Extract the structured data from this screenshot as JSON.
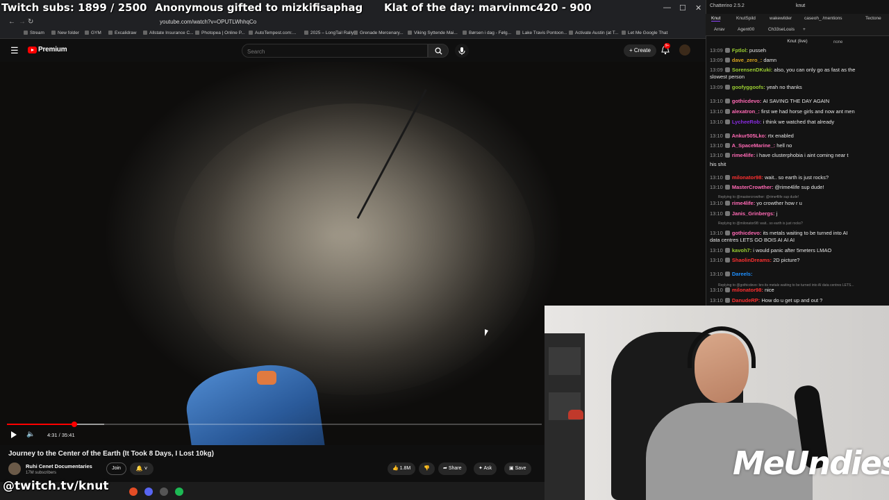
{
  "overlay": {
    "subs": "Twitch subs: 1899 / 2500",
    "gifted": "Anonymous gifted to mizkifisaphag",
    "klat": "Klat of the day: marvinmc420 - 900"
  },
  "browser": {
    "url": "youtube.com/watch?v=OPUTLWhhqCo",
    "bookmarks": [
      "Stream",
      "New folder",
      "GYM",
      "Excalidraw",
      "Allstate Insurance C...",
      "Photopea | Online P...",
      "AutoTempest.com:...",
      "2025 – LongTail Rally",
      "Grenade Mercenary...",
      "Viking Syttende Mai...",
      "Børsen i dag - Følg...",
      "Lake Travis Pontoon...",
      "Activate Austin (at T...",
      "Let Me Google That"
    ]
  },
  "youtube": {
    "brand": "Premium",
    "search_placeholder": "Search",
    "create_label": "Create",
    "notifications": "9+",
    "time": "4:31 / 35:41",
    "progress": 0.126,
    "title": "Journey to the Center of the Earth (It Took 8 Days, I Lost 10kg)",
    "channel": "Ruhi Cenet Documentaries",
    "subscribers": "17M subscribers",
    "join_label": "Join",
    "likes": "1.8M",
    "share_label": "Share",
    "ask_label": "Ask",
    "save_label": "Save"
  },
  "chat": {
    "app_title": "Chatterino 2.5.2",
    "user": "knut",
    "tabs_row1": [
      "Knut",
      "KnutSpild",
      "wakewilder",
      "caseoh_ /mentions",
      "Tectone"
    ],
    "tabs_row2": [
      "Arrav",
      "Agent00",
      "Ch33seLouis"
    ],
    "channel": "Knut (live)",
    "mode": "none",
    "messages": [
      {
        "time": "13:09",
        "user": "Fptlol:",
        "color": "#9acd32",
        "text": "pusseh"
      },
      {
        "time": "13:09",
        "user": "dave_zero_:",
        "color": "#daa520",
        "text": "damn"
      },
      {
        "time": "13:09",
        "user": "SorensenDKuki:",
        "color": "#9acd32",
        "text": "also, you can only go as fast as the"
      },
      {
        "time": "",
        "user": "",
        "color": "#e8e8e8",
        "text": "slowest person"
      },
      {
        "time": "13:09",
        "user": "goofyggoofs:",
        "color": "#9acd32",
        "text": "yeah no thanks"
      },
      {
        "time": "13:10",
        "user": "gothicdevo:",
        "color": "#ff69b4",
        "text": "AI SAVING THE DAY AGAIN"
      },
      {
        "time": "13:10",
        "user": "alexatron_:",
        "color": "#ff69b4",
        "text": "first we had horse girls and now ant men"
      },
      {
        "time": "13:10",
        "user": "LycheeRob:",
        "color": "#8a2be2",
        "text": "i think we watched that already"
      },
      {
        "time": "13:10",
        "user": "Ankur505Lko:",
        "color": "#ff69b4",
        "text": "rtx enabled"
      },
      {
        "time": "13:10",
        "user": "A_SpaceMarine_:",
        "color": "#ff69b4",
        "text": "hell no"
      },
      {
        "time": "13:10",
        "user": "rime4life:",
        "color": "#ff69b4",
        "text": "i have clusterphobia i aint coming near t"
      },
      {
        "time": "",
        "user": "",
        "color": "#e8e8e8",
        "text": "his shit"
      },
      {
        "time": "13:10",
        "user": "milonator98:",
        "color": "#ff3030",
        "text": "wait.. so earth is just rocks?"
      },
      {
        "time": "13:10",
        "user": "MasterCrowther:",
        "color": "#ff69b4",
        "text": "@rime4life sup dude!"
      },
      {
        "time": "13:10",
        "user": "rime4life:",
        "color": "#ff69b4",
        "text": "yo crowther how r u"
      },
      {
        "time": "13:10",
        "user": "Janis_Grinbergs:",
        "color": "#ff69b4",
        "text": "j"
      },
      {
        "time": "13:10",
        "user": "gothicdevo:",
        "color": "#ff69b4",
        "text": "its metals waiting to be turned into AI"
      },
      {
        "time": "",
        "user": "",
        "color": "#e8e8e8",
        "text": "data centres LETS GO BOIS AI AI AI"
      },
      {
        "time": "13:10",
        "user": "kavoh7:",
        "color": "#9acd32",
        "text": "i would panic after 5meters LMAO"
      },
      {
        "time": "13:10",
        "user": "ShaolinDreams:",
        "color": "#ff3030",
        "text": "2D picture?"
      },
      {
        "time": "13:10",
        "user": "Dareels:",
        "color": "#1e90ff",
        "text": ""
      },
      {
        "time": "13:10",
        "user": "milonator98:",
        "color": "#ff3030",
        "text": "nice"
      },
      {
        "time": "13:10",
        "user": "DanudeRP:",
        "color": "#ff3030",
        "text": "How do u get up and out ?"
      }
    ],
    "replies": [
      {
        "text": "Replying to @mastercrowther: @rime4life sup dude!"
      },
      {
        "text": "Replying to @milonator98: wait.. so earth is just rocks?"
      },
      {
        "text": "Replying to @gothicdevo: bro its metals waiting to be turned into AI data centres LETS..."
      }
    ]
  },
  "stream": {
    "twitch_url": "@twitch.tv/knut",
    "sponsor": "MeUndies"
  }
}
